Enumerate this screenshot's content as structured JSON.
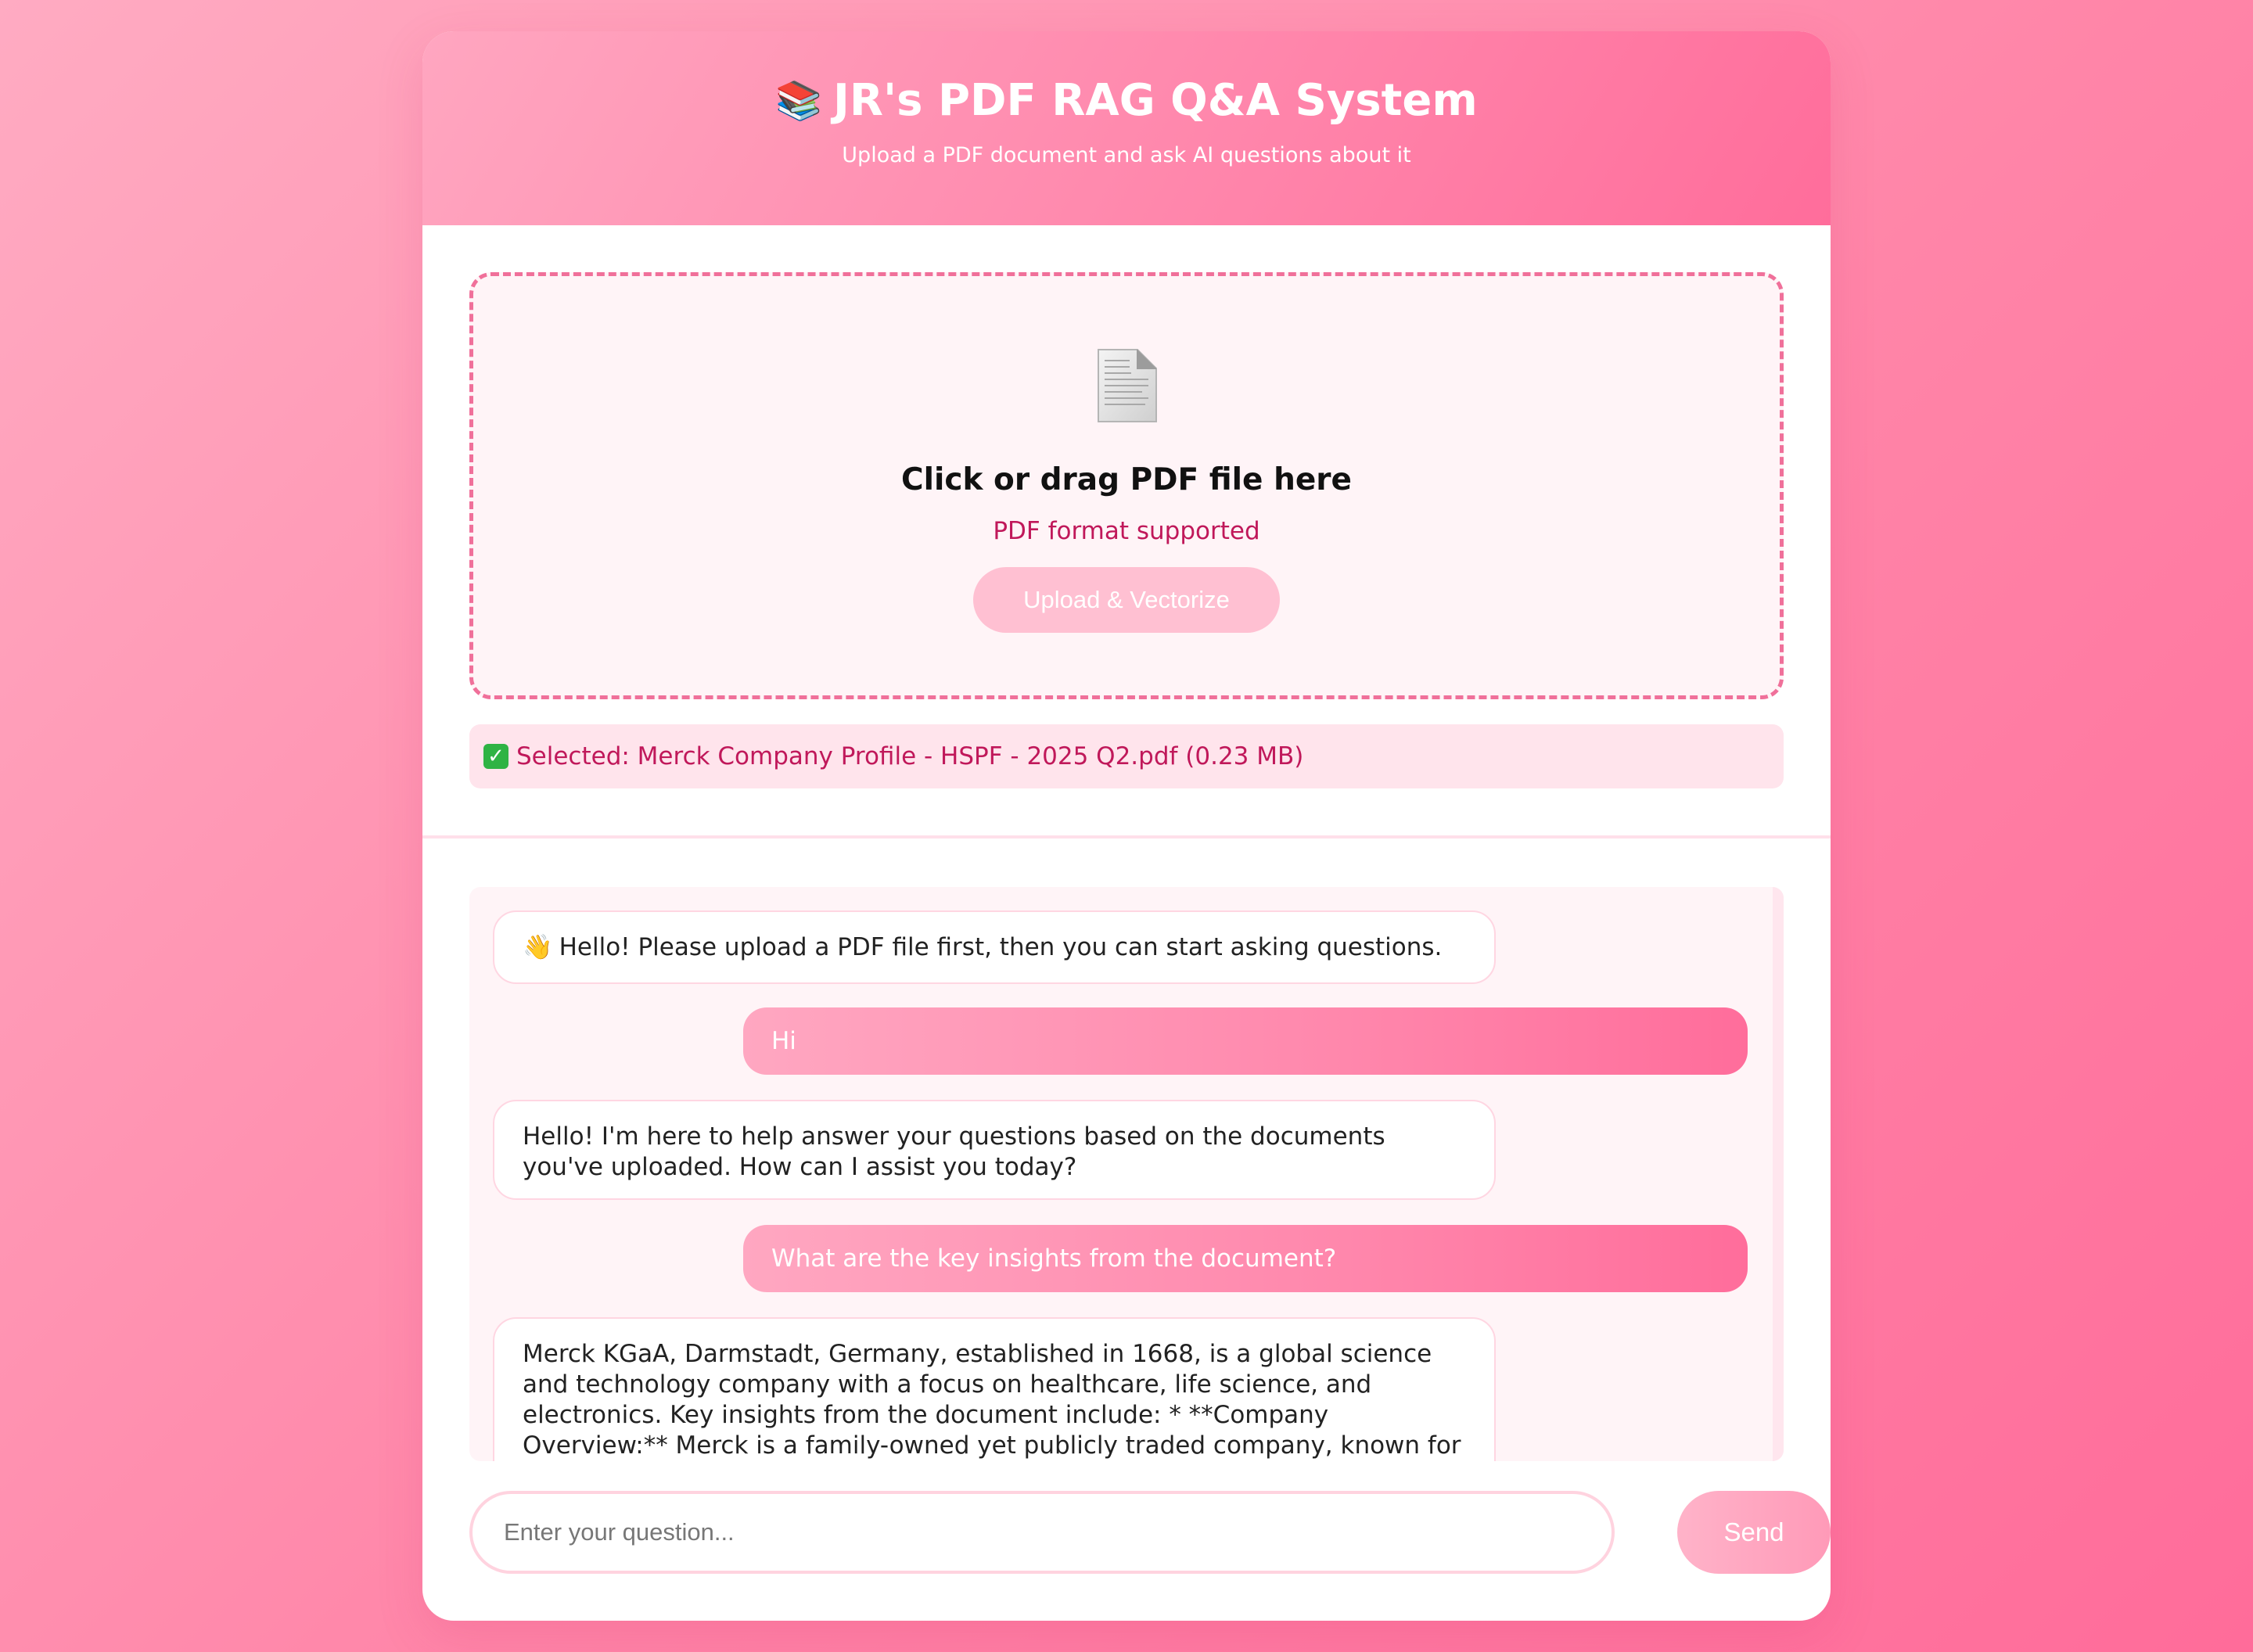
{
  "header": {
    "title_icon": "books-icon",
    "title_icon_glyph": "📚",
    "title": "JR's PDF RAG Q&A System",
    "subtitle": "Upload a PDF document and ask AI questions about it"
  },
  "upload": {
    "doc_icon": "document-icon",
    "drop_title": "Click or drag PDF file here",
    "drop_hint": "PDF format supported",
    "upload_button_label": "Upload & Vectorize",
    "selected_icon": "check-icon",
    "selected_text": "Selected: Merck Company Profile - HSPF - 2025 Q2.pdf (0.23 MB)"
  },
  "chat": {
    "messages": [
      {
        "role": "bot",
        "icon": "wave-icon",
        "icon_glyph": "👋",
        "text": "Hello! Please upload a PDF file first, then you can start asking questions."
      },
      {
        "role": "user",
        "text": "Hi"
      },
      {
        "role": "bot",
        "text": "Hello! I'm here to help answer your questions based on the documents you've uploaded. How can I assist you today?"
      },
      {
        "role": "user",
        "text": "What are the key insights from the document?"
      },
      {
        "role": "bot",
        "text": "Merck KGaA, Darmstadt, Germany, established in 1668, is a global science and technology company with a focus on healthcare, life science, and electronics. Key insights from the document include: * **Company Overview:** Merck is a family-owned yet publicly traded company, known for its innovation and commitment to"
      }
    ]
  },
  "input": {
    "placeholder": "Enter your question...",
    "value": "",
    "send_label": "Send"
  },
  "colors": {
    "accent": "#ff6d9b",
    "accent_light": "#ffa6c0",
    "text_accent": "#c0185a",
    "dropzone_border": "#f0709a",
    "check_green": "#2fb344"
  }
}
